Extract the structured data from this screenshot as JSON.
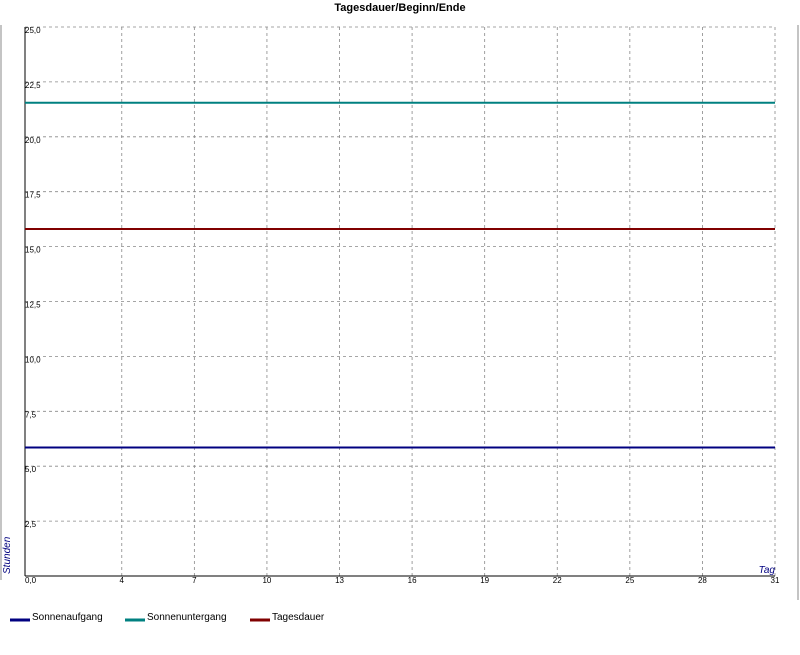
{
  "chart_data": {
    "type": "line",
    "title": "Tagesdauer/Beginn/Ende",
    "xlabel": "Tag",
    "ylabel": "Stunden",
    "xlim": [
      0,
      31
    ],
    "ylim": [
      0,
      25
    ],
    "x_ticks": [
      0,
      4,
      7,
      10,
      13,
      16,
      19,
      22,
      25,
      28,
      31
    ],
    "x_tick_labels": [
      "0,0",
      "4",
      "7",
      "10",
      "13",
      "16",
      "19",
      "22",
      "25",
      "28",
      "31"
    ],
    "y_ticks": [
      2.5,
      5,
      7.5,
      10,
      12.5,
      15,
      17.5,
      20,
      22.5,
      25
    ],
    "y_tick_labels": [
      "2,5",
      "5,0",
      "7,5",
      "10,0",
      "12,5",
      "15,0",
      "17,5",
      "20,0",
      "22,5",
      "25,0"
    ],
    "grid": true,
    "legend_position": "bottom-left",
    "series": [
      {
        "name": "Sonnenaufgang",
        "color": "#000080",
        "x": [
          0,
          31
        ],
        "y": [
          5.85,
          5.85
        ]
      },
      {
        "name": "Sonnenuntergang",
        "color": "#008080",
        "x": [
          0,
          31
        ],
        "y": [
          21.55,
          21.55
        ]
      },
      {
        "name": "Tagesdauer",
        "color": "#800000",
        "x": [
          0,
          31
        ],
        "y": [
          15.8,
          15.8
        ]
      }
    ]
  }
}
